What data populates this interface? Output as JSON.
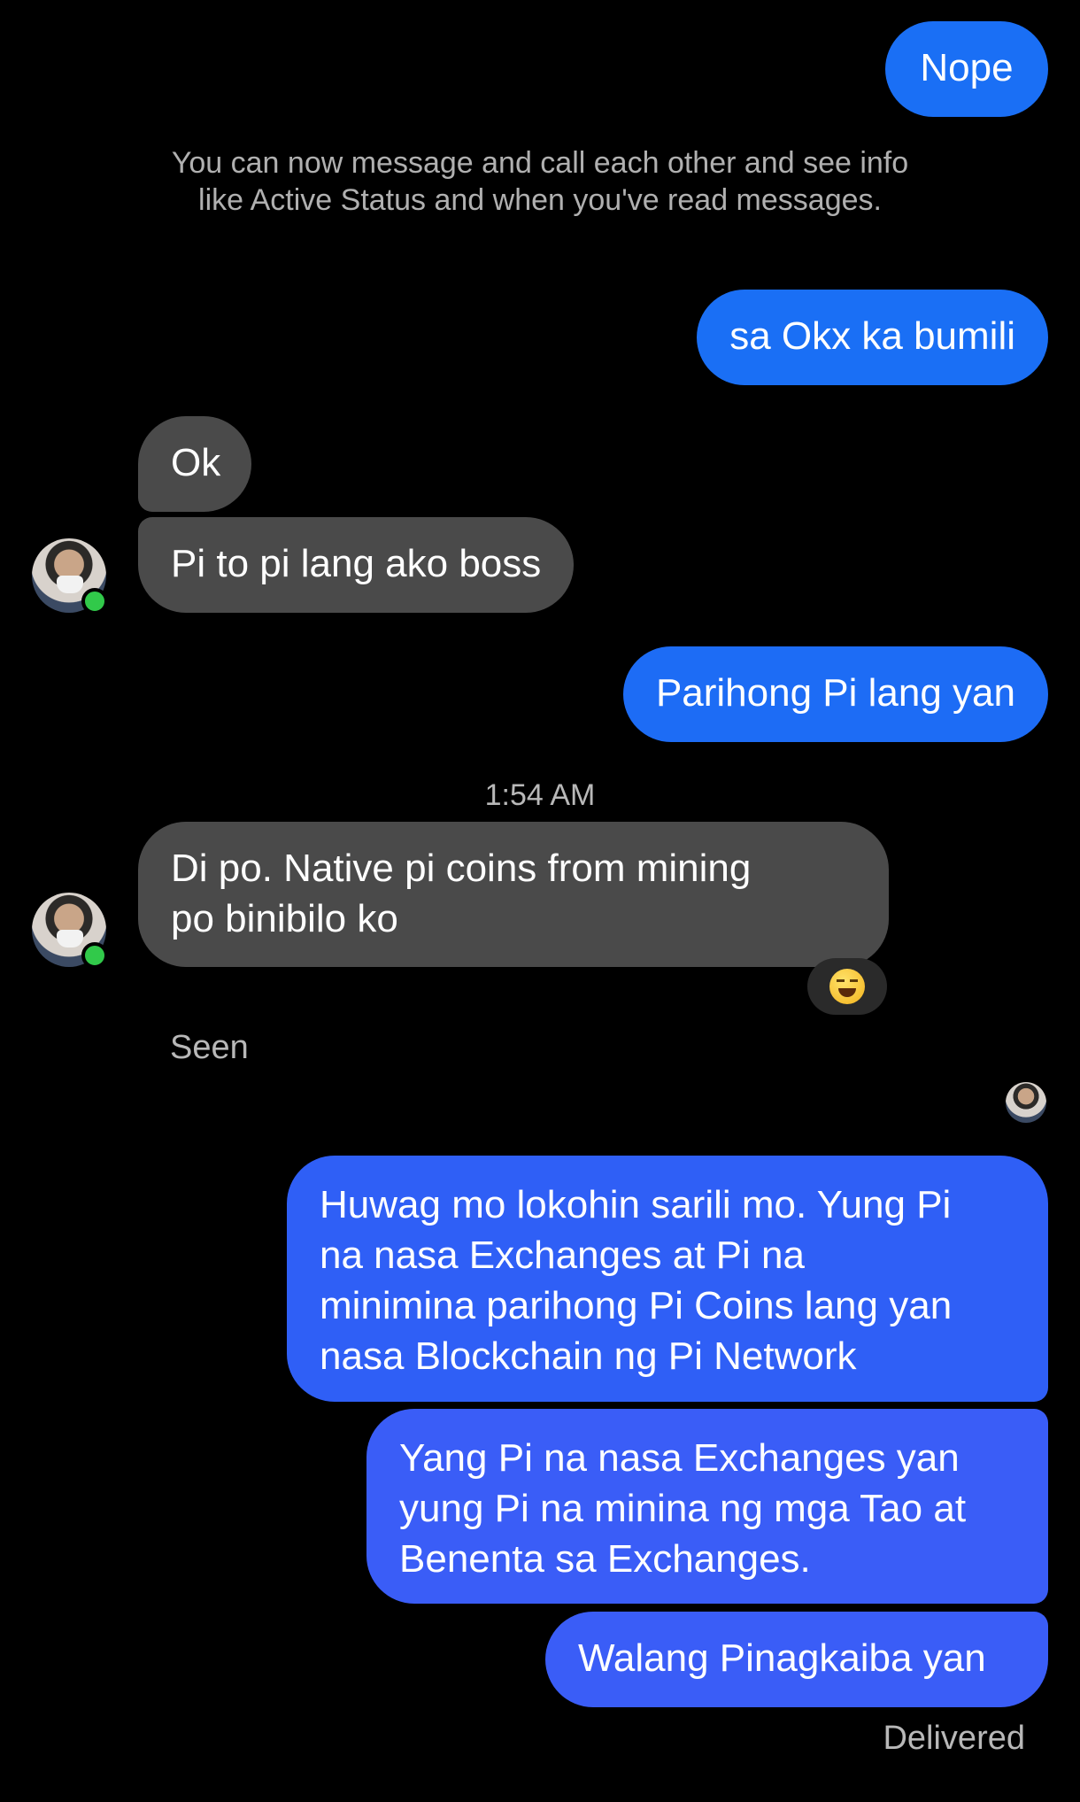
{
  "messages": {
    "m1": "Nope",
    "system_notice": "You can now message and call each other and see info like Active Status and when you've read messages.",
    "m2": "sa Okx ka bumili",
    "m3": "Ok",
    "m4": "Pi to pi lang ako boss",
    "m5": "Parihong Pi lang yan",
    "timestamp": "1:54 AM",
    "m6_line1": "Di po. Native pi coins from mining",
    "m6_line2": "po binibilo ko",
    "seen": "Seen",
    "m7_line1": "Huwag mo lokohin sarili mo. Yung Pi",
    "m7_line2": "na nasa Exchanges at Pi na",
    "m7_line3": "minimina parihong Pi Coins lang yan",
    "m7_line4": "nasa Blockchain ng Pi Network",
    "m8_line1": "Yang Pi na nasa Exchanges yan",
    "m8_line2": "yung Pi na minina ng mga Tao at",
    "m8_line3": "Benenta sa Exchanges.",
    "m9": "Walang Pinagkaiba yan",
    "delivered": "Delivered"
  },
  "reaction": "laughing-face",
  "colors": {
    "outgoing_top": "#1a6ff5",
    "outgoing_bottom": "#3a5df7",
    "incoming": "#4a4a4a",
    "background": "#000000"
  }
}
